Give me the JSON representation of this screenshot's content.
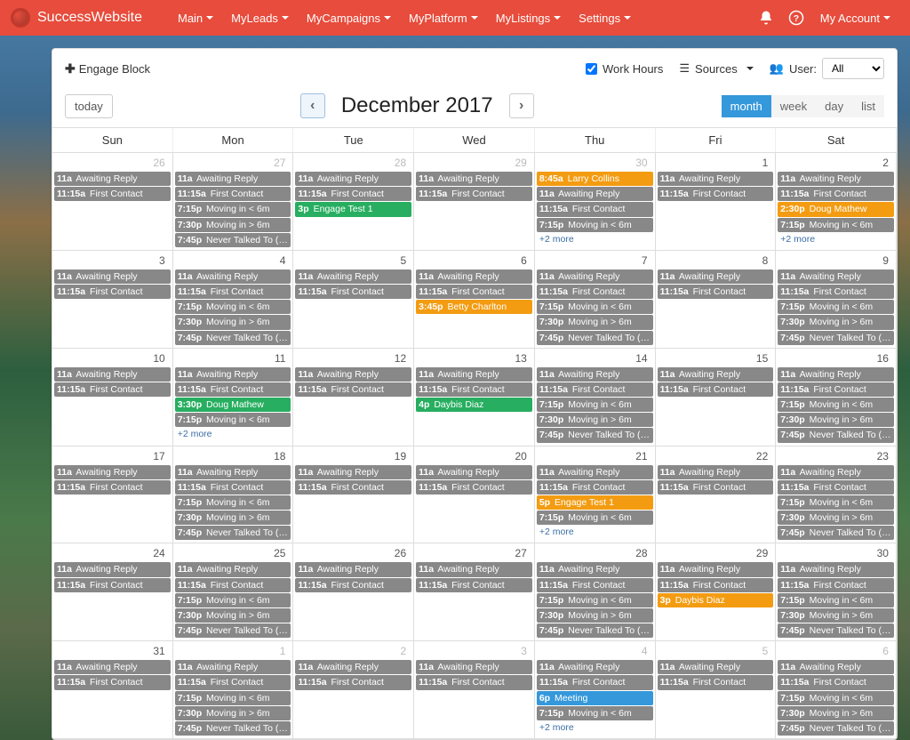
{
  "brand": "SuccessWebsite",
  "nav": [
    "Main",
    "MyLeads",
    "MyCampaigns",
    "MyPlatform",
    "MyListings",
    "Settings"
  ],
  "account": "My Account",
  "engage": "Engage Block",
  "filters": {
    "work": "Work Hours",
    "sources": "Sources",
    "user": "User:",
    "all": "All"
  },
  "today": "today",
  "title": "December 2017",
  "views": {
    "month": "month",
    "week": "week",
    "day": "day",
    "list": "list"
  },
  "dows": [
    "Sun",
    "Mon",
    "Tue",
    "Wed",
    "Thu",
    "Fri",
    "Sat"
  ],
  "weeks": [
    [
      {
        "n": "26",
        "fade": true,
        "ev": [
          {
            "t": "11a",
            "x": "Awaiting Reply",
            "c": "gray"
          },
          {
            "t": "11:15a",
            "x": "First Contact",
            "c": "gray"
          }
        ]
      },
      {
        "n": "27",
        "fade": true,
        "ev": [
          {
            "t": "11a",
            "x": "Awaiting Reply",
            "c": "gray"
          },
          {
            "t": "11:15a",
            "x": "First Contact",
            "c": "gray"
          },
          {
            "t": "7:15p",
            "x": "Moving in < 6m",
            "c": "gray"
          },
          {
            "t": "7:30p",
            "x": "Moving in > 6m",
            "c": "gray"
          },
          {
            "t": "7:45p",
            "x": "Never Talked To (first",
            "c": "gray"
          }
        ]
      },
      {
        "n": "28",
        "fade": true,
        "ev": [
          {
            "t": "11a",
            "x": "Awaiting Reply",
            "c": "gray"
          },
          {
            "t": "11:15a",
            "x": "First Contact",
            "c": "gray"
          },
          {
            "t": "3p",
            "x": "Engage Test 1",
            "c": "green"
          }
        ]
      },
      {
        "n": "29",
        "fade": true,
        "ev": [
          {
            "t": "11a",
            "x": "Awaiting Reply",
            "c": "gray"
          },
          {
            "t": "11:15a",
            "x": "First Contact",
            "c": "gray"
          }
        ]
      },
      {
        "n": "30",
        "fade": true,
        "ev": [
          {
            "t": "8:45a",
            "x": "Larry Collins",
            "c": "orange"
          },
          {
            "t": "11a",
            "x": "Awaiting Reply",
            "c": "gray"
          },
          {
            "t": "11:15a",
            "x": "First Contact",
            "c": "gray"
          },
          {
            "t": "7:15p",
            "x": "Moving in < 6m",
            "c": "gray"
          }
        ],
        "more": "+2 more"
      },
      {
        "n": "1",
        "ev": [
          {
            "t": "11a",
            "x": "Awaiting Reply",
            "c": "gray"
          },
          {
            "t": "11:15a",
            "x": "First Contact",
            "c": "gray"
          }
        ]
      },
      {
        "n": "2",
        "ev": [
          {
            "t": "11a",
            "x": "Awaiting Reply",
            "c": "gray"
          },
          {
            "t": "11:15a",
            "x": "First Contact",
            "c": "gray"
          },
          {
            "t": "2:30p",
            "x": "Doug Mathew",
            "c": "orange"
          },
          {
            "t": "7:15p",
            "x": "Moving in < 6m",
            "c": "gray"
          }
        ],
        "more": "+2 more"
      }
    ],
    [
      {
        "n": "3",
        "ev": [
          {
            "t": "11a",
            "x": "Awaiting Reply",
            "c": "gray"
          },
          {
            "t": "11:15a",
            "x": "First Contact",
            "c": "gray"
          }
        ]
      },
      {
        "n": "4",
        "ev": [
          {
            "t": "11a",
            "x": "Awaiting Reply",
            "c": "gray"
          },
          {
            "t": "11:15a",
            "x": "First Contact",
            "c": "gray"
          },
          {
            "t": "7:15p",
            "x": "Moving in < 6m",
            "c": "gray"
          },
          {
            "t": "7:30p",
            "x": "Moving in > 6m",
            "c": "gray"
          },
          {
            "t": "7:45p",
            "x": "Never Talked To (first",
            "c": "gray"
          }
        ]
      },
      {
        "n": "5",
        "ev": [
          {
            "t": "11a",
            "x": "Awaiting Reply",
            "c": "gray"
          },
          {
            "t": "11:15a",
            "x": "First Contact",
            "c": "gray"
          }
        ]
      },
      {
        "n": "6",
        "ev": [
          {
            "t": "11a",
            "x": "Awaiting Reply",
            "c": "gray"
          },
          {
            "t": "11:15a",
            "x": "First Contact",
            "c": "gray"
          },
          {
            "t": "3:45p",
            "x": "Betty Charlton",
            "c": "orange"
          }
        ]
      },
      {
        "n": "7",
        "ev": [
          {
            "t": "11a",
            "x": "Awaiting Reply",
            "c": "gray"
          },
          {
            "t": "11:15a",
            "x": "First Contact",
            "c": "gray"
          },
          {
            "t": "7:15p",
            "x": "Moving in < 6m",
            "c": "gray"
          },
          {
            "t": "7:30p",
            "x": "Moving in > 6m",
            "c": "gray"
          },
          {
            "t": "7:45p",
            "x": "Never Talked To (first",
            "c": "gray"
          }
        ]
      },
      {
        "n": "8",
        "ev": [
          {
            "t": "11a",
            "x": "Awaiting Reply",
            "c": "gray"
          },
          {
            "t": "11:15a",
            "x": "First Contact",
            "c": "gray"
          }
        ]
      },
      {
        "n": "9",
        "ev": [
          {
            "t": "11a",
            "x": "Awaiting Reply",
            "c": "gray"
          },
          {
            "t": "11:15a",
            "x": "First Contact",
            "c": "gray"
          },
          {
            "t": "7:15p",
            "x": "Moving in < 6m",
            "c": "gray"
          },
          {
            "t": "7:30p",
            "x": "Moving in > 6m",
            "c": "gray"
          },
          {
            "t": "7:45p",
            "x": "Never Talked To (first",
            "c": "gray"
          }
        ]
      }
    ],
    [
      {
        "n": "10",
        "ev": [
          {
            "t": "11a",
            "x": "Awaiting Reply",
            "c": "gray"
          },
          {
            "t": "11:15a",
            "x": "First Contact",
            "c": "gray"
          }
        ]
      },
      {
        "n": "11",
        "ev": [
          {
            "t": "11a",
            "x": "Awaiting Reply",
            "c": "gray"
          },
          {
            "t": "11:15a",
            "x": "First Contact",
            "c": "gray"
          },
          {
            "t": "3:30p",
            "x": "Doug Mathew",
            "c": "green"
          },
          {
            "t": "7:15p",
            "x": "Moving in < 6m",
            "c": "gray"
          }
        ],
        "more": "+2 more"
      },
      {
        "n": "12",
        "ev": [
          {
            "t": "11a",
            "x": "Awaiting Reply",
            "c": "gray"
          },
          {
            "t": "11:15a",
            "x": "First Contact",
            "c": "gray"
          }
        ]
      },
      {
        "n": "13",
        "ev": [
          {
            "t": "11a",
            "x": "Awaiting Reply",
            "c": "gray"
          },
          {
            "t": "11:15a",
            "x": "First Contact",
            "c": "gray"
          },
          {
            "t": "4p",
            "x": "Daybis Diaz",
            "c": "green"
          }
        ]
      },
      {
        "n": "14",
        "ev": [
          {
            "t": "11a",
            "x": "Awaiting Reply",
            "c": "gray"
          },
          {
            "t": "11:15a",
            "x": "First Contact",
            "c": "gray"
          },
          {
            "t": "7:15p",
            "x": "Moving in < 6m",
            "c": "gray"
          },
          {
            "t": "7:30p",
            "x": "Moving in > 6m",
            "c": "gray"
          },
          {
            "t": "7:45p",
            "x": "Never Talked To (first",
            "c": "gray"
          }
        ]
      },
      {
        "n": "15",
        "ev": [
          {
            "t": "11a",
            "x": "Awaiting Reply",
            "c": "gray"
          },
          {
            "t": "11:15a",
            "x": "First Contact",
            "c": "gray"
          }
        ]
      },
      {
        "n": "16",
        "ev": [
          {
            "t": "11a",
            "x": "Awaiting Reply",
            "c": "gray"
          },
          {
            "t": "11:15a",
            "x": "First Contact",
            "c": "gray"
          },
          {
            "t": "7:15p",
            "x": "Moving in < 6m",
            "c": "gray"
          },
          {
            "t": "7:30p",
            "x": "Moving in > 6m",
            "c": "gray"
          },
          {
            "t": "7:45p",
            "x": "Never Talked To (first",
            "c": "gray"
          }
        ]
      }
    ],
    [
      {
        "n": "17",
        "ev": [
          {
            "t": "11a",
            "x": "Awaiting Reply",
            "c": "gray"
          },
          {
            "t": "11:15a",
            "x": "First Contact",
            "c": "gray"
          }
        ]
      },
      {
        "n": "18",
        "ev": [
          {
            "t": "11a",
            "x": "Awaiting Reply",
            "c": "gray"
          },
          {
            "t": "11:15a",
            "x": "First Contact",
            "c": "gray"
          },
          {
            "t": "7:15p",
            "x": "Moving in < 6m",
            "c": "gray"
          },
          {
            "t": "7:30p",
            "x": "Moving in > 6m",
            "c": "gray"
          },
          {
            "t": "7:45p",
            "x": "Never Talked To (first",
            "c": "gray"
          }
        ]
      },
      {
        "n": "19",
        "ev": [
          {
            "t": "11a",
            "x": "Awaiting Reply",
            "c": "gray"
          },
          {
            "t": "11:15a",
            "x": "First Contact",
            "c": "gray"
          }
        ]
      },
      {
        "n": "20",
        "ev": [
          {
            "t": "11a",
            "x": "Awaiting Reply",
            "c": "gray"
          },
          {
            "t": "11:15a",
            "x": "First Contact",
            "c": "gray"
          }
        ]
      },
      {
        "n": "21",
        "ev": [
          {
            "t": "11a",
            "x": "Awaiting Reply",
            "c": "gray"
          },
          {
            "t": "11:15a",
            "x": "First Contact",
            "c": "gray"
          },
          {
            "t": "5p",
            "x": "Engage Test 1",
            "c": "orange"
          },
          {
            "t": "7:15p",
            "x": "Moving in < 6m",
            "c": "gray"
          }
        ],
        "more": "+2 more"
      },
      {
        "n": "22",
        "ev": [
          {
            "t": "11a",
            "x": "Awaiting Reply",
            "c": "gray"
          },
          {
            "t": "11:15a",
            "x": "First Contact",
            "c": "gray"
          }
        ]
      },
      {
        "n": "23",
        "ev": [
          {
            "t": "11a",
            "x": "Awaiting Reply",
            "c": "gray"
          },
          {
            "t": "11:15a",
            "x": "First Contact",
            "c": "gray"
          },
          {
            "t": "7:15p",
            "x": "Moving in < 6m",
            "c": "gray"
          },
          {
            "t": "7:30p",
            "x": "Moving in > 6m",
            "c": "gray"
          },
          {
            "t": "7:45p",
            "x": "Never Talked To (first",
            "c": "gray"
          }
        ]
      }
    ],
    [
      {
        "n": "24",
        "ev": [
          {
            "t": "11a",
            "x": "Awaiting Reply",
            "c": "gray"
          },
          {
            "t": "11:15a",
            "x": "First Contact",
            "c": "gray"
          }
        ]
      },
      {
        "n": "25",
        "ev": [
          {
            "t": "11a",
            "x": "Awaiting Reply",
            "c": "gray"
          },
          {
            "t": "11:15a",
            "x": "First Contact",
            "c": "gray"
          },
          {
            "t": "7:15p",
            "x": "Moving in < 6m",
            "c": "gray"
          },
          {
            "t": "7:30p",
            "x": "Moving in > 6m",
            "c": "gray"
          },
          {
            "t": "7:45p",
            "x": "Never Talked To (first",
            "c": "gray"
          }
        ]
      },
      {
        "n": "26",
        "ev": [
          {
            "t": "11a",
            "x": "Awaiting Reply",
            "c": "gray"
          },
          {
            "t": "11:15a",
            "x": "First Contact",
            "c": "gray"
          }
        ]
      },
      {
        "n": "27",
        "ev": [
          {
            "t": "11a",
            "x": "Awaiting Reply",
            "c": "gray"
          },
          {
            "t": "11:15a",
            "x": "First Contact",
            "c": "gray"
          }
        ]
      },
      {
        "n": "28",
        "ev": [
          {
            "t": "11a",
            "x": "Awaiting Reply",
            "c": "gray"
          },
          {
            "t": "11:15a",
            "x": "First Contact",
            "c": "gray"
          },
          {
            "t": "7:15p",
            "x": "Moving in < 6m",
            "c": "gray"
          },
          {
            "t": "7:30p",
            "x": "Moving in > 6m",
            "c": "gray"
          },
          {
            "t": "7:45p",
            "x": "Never Talked To (first",
            "c": "gray"
          }
        ]
      },
      {
        "n": "29",
        "ev": [
          {
            "t": "11a",
            "x": "Awaiting Reply",
            "c": "gray"
          },
          {
            "t": "11:15a",
            "x": "First Contact",
            "c": "gray"
          },
          {
            "t": "3p",
            "x": "Daybis Diaz",
            "c": "orange"
          }
        ]
      },
      {
        "n": "30",
        "ev": [
          {
            "t": "11a",
            "x": "Awaiting Reply",
            "c": "gray"
          },
          {
            "t": "11:15a",
            "x": "First Contact",
            "c": "gray"
          },
          {
            "t": "7:15p",
            "x": "Moving in < 6m",
            "c": "gray"
          },
          {
            "t": "7:30p",
            "x": "Moving in > 6m",
            "c": "gray"
          },
          {
            "t": "7:45p",
            "x": "Never Talked To (first",
            "c": "gray"
          }
        ]
      }
    ],
    [
      {
        "n": "31",
        "ev": [
          {
            "t": "11a",
            "x": "Awaiting Reply",
            "c": "gray"
          },
          {
            "t": "11:15a",
            "x": "First Contact",
            "c": "gray"
          }
        ]
      },
      {
        "n": "1",
        "fade": true,
        "ev": [
          {
            "t": "11a",
            "x": "Awaiting Reply",
            "c": "gray"
          },
          {
            "t": "11:15a",
            "x": "First Contact",
            "c": "gray"
          },
          {
            "t": "7:15p",
            "x": "Moving in < 6m",
            "c": "gray"
          },
          {
            "t": "7:30p",
            "x": "Moving in > 6m",
            "c": "gray"
          },
          {
            "t": "7:45p",
            "x": "Never Talked To (first",
            "c": "gray"
          }
        ]
      },
      {
        "n": "2",
        "fade": true,
        "ev": [
          {
            "t": "11a",
            "x": "Awaiting Reply",
            "c": "gray"
          },
          {
            "t": "11:15a",
            "x": "First Contact",
            "c": "gray"
          }
        ]
      },
      {
        "n": "3",
        "fade": true,
        "ev": [
          {
            "t": "11a",
            "x": "Awaiting Reply",
            "c": "gray"
          },
          {
            "t": "11:15a",
            "x": "First Contact",
            "c": "gray"
          }
        ]
      },
      {
        "n": "4",
        "fade": true,
        "ev": [
          {
            "t": "11a",
            "x": "Awaiting Reply",
            "c": "gray"
          },
          {
            "t": "11:15a",
            "x": "First Contact",
            "c": "gray"
          },
          {
            "t": "6p",
            "x": "Meeting",
            "c": "blue"
          },
          {
            "t": "7:15p",
            "x": "Moving in < 6m",
            "c": "gray"
          }
        ],
        "more": "+2 more"
      },
      {
        "n": "5",
        "fade": true,
        "ev": [
          {
            "t": "11a",
            "x": "Awaiting Reply",
            "c": "gray"
          },
          {
            "t": "11:15a",
            "x": "First Contact",
            "c": "gray"
          }
        ]
      },
      {
        "n": "6",
        "fade": true,
        "ev": [
          {
            "t": "11a",
            "x": "Awaiting Reply",
            "c": "gray"
          },
          {
            "t": "11:15a",
            "x": "First Contact",
            "c": "gray"
          },
          {
            "t": "7:15p",
            "x": "Moving in < 6m",
            "c": "gray"
          },
          {
            "t": "7:30p",
            "x": "Moving in > 6m",
            "c": "gray"
          },
          {
            "t": "7:45p",
            "x": "Never Talked To (first",
            "c": "gray"
          }
        ]
      }
    ]
  ]
}
